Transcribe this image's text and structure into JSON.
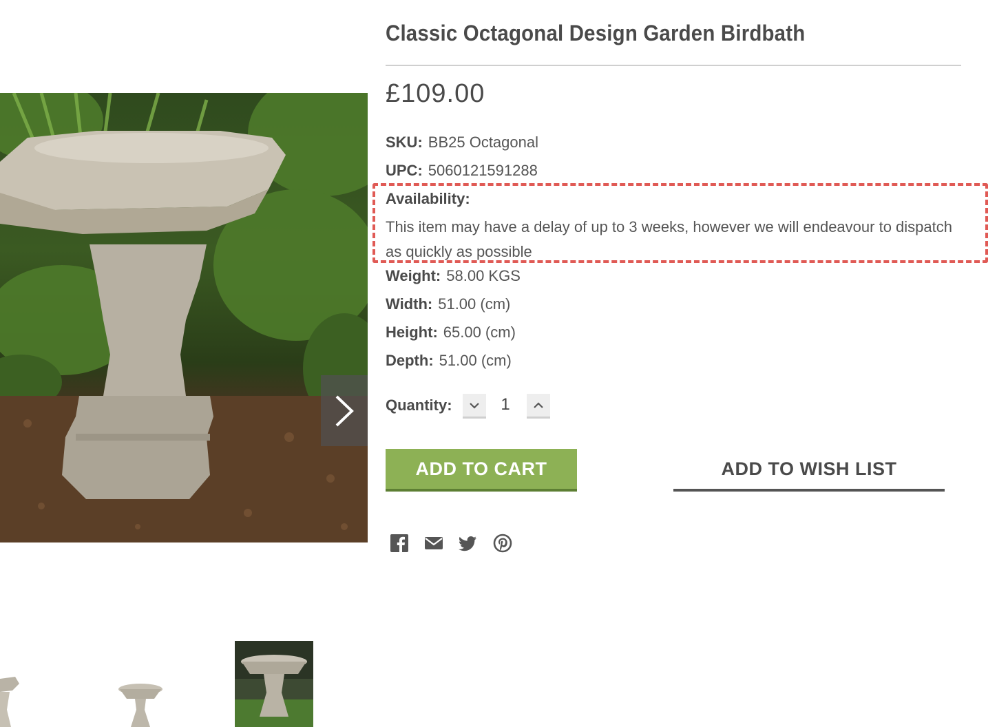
{
  "product": {
    "title": "Classic Octagonal Design Garden Birdbath",
    "price": "£109.00"
  },
  "specs": {
    "sku": {
      "label": "SKU:",
      "value": "BB25 Octagonal"
    },
    "upc": {
      "label": "UPC:",
      "value": "5060121591288"
    },
    "availability": {
      "label": "Availability:",
      "value": "This item may have a delay of up to 3 weeks, however we will endeavour to dispatch as quickly as possible"
    },
    "weight": {
      "label": "Weight:",
      "value": "58.00 KGS"
    },
    "width": {
      "label": "Width:",
      "value": "51.00 (cm)"
    },
    "height": {
      "label": "Height:",
      "value": "65.00 (cm)"
    },
    "depth": {
      "label": "Depth:",
      "value": "51.00 (cm)"
    }
  },
  "quantity": {
    "label": "Quantity:",
    "value": "1"
  },
  "actions": {
    "add_to_cart": "ADD TO CART",
    "add_to_wish_list": "ADD TO WISH LIST"
  },
  "social_icons": [
    "facebook-icon",
    "email-icon",
    "twitter-icon",
    "pinterest-icon"
  ],
  "colors": {
    "accent_green": "#8db155",
    "highlight_red": "#e05a55",
    "text_dark": "#4a4a4a"
  }
}
